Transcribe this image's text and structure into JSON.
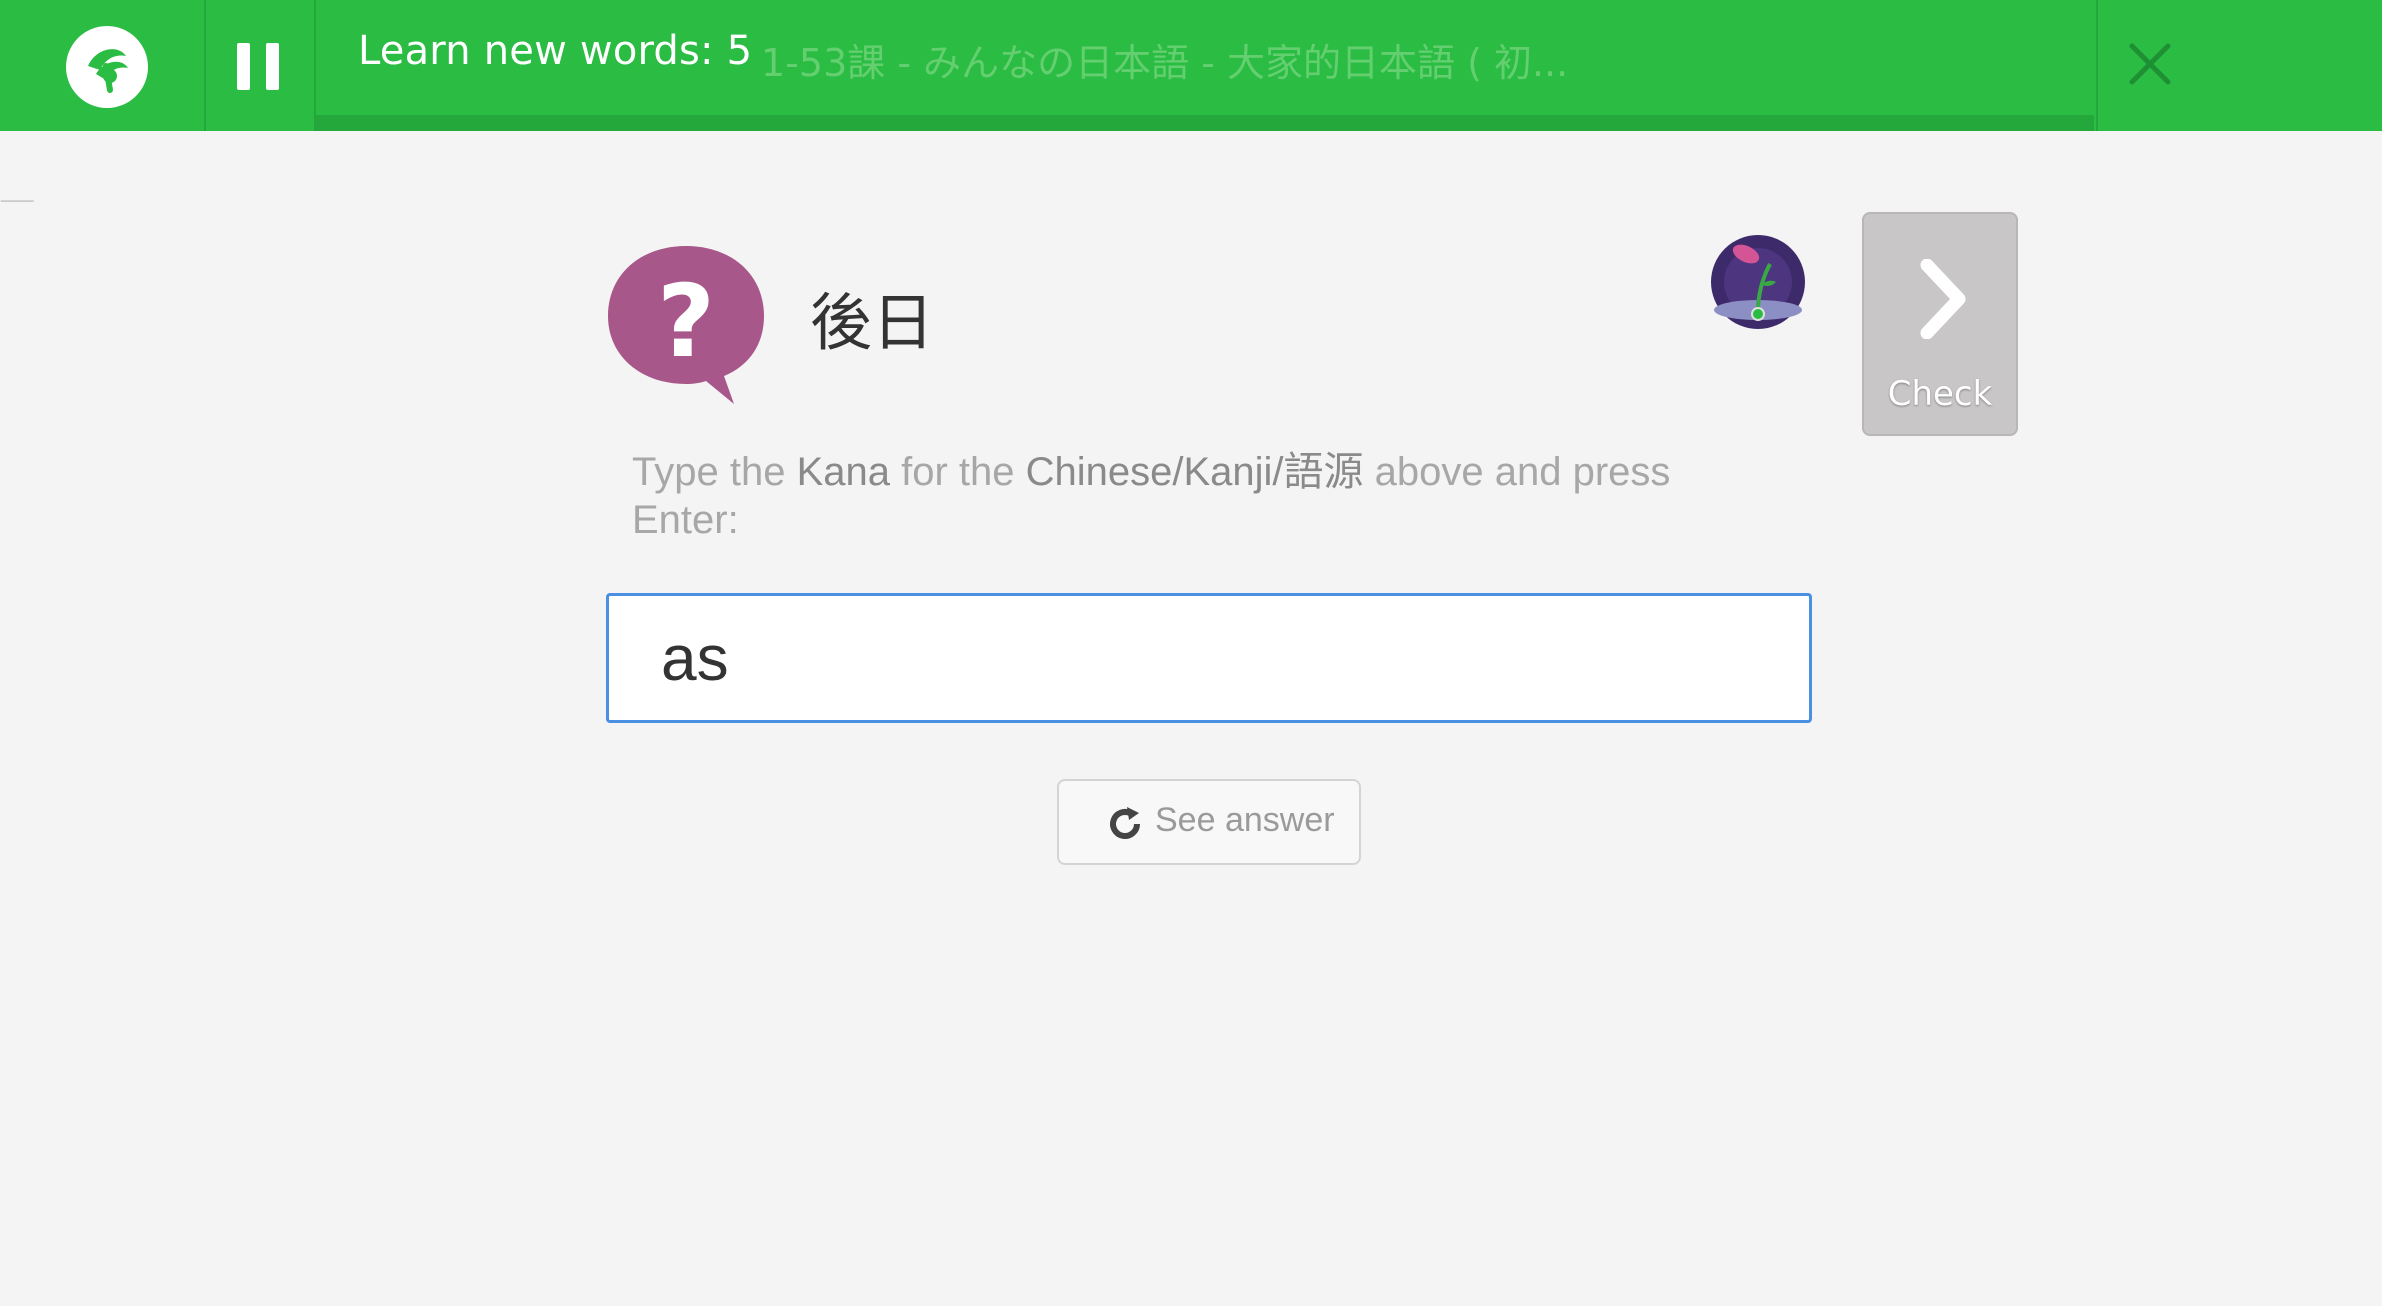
{
  "header": {
    "title": "Learn new words: 5",
    "course": "1-53課 - みんなの日本語 - 大家的日本語 ( 初...",
    "logo_icon": "memrise-sprout-icon",
    "pause_icon": "pause-icon",
    "close_icon": "close-icon"
  },
  "question": {
    "icon": "question-bubble-icon",
    "prompt": "後日",
    "mem_icon": "flower-mem-icon",
    "instruction_parts": {
      "p1": "Type the ",
      "b1": "Kana",
      "p2": " for the ",
      "b2": "Chinese/Kanji/語源",
      "p3": " above and press Enter:"
    }
  },
  "answer": {
    "value": "as"
  },
  "actions": {
    "check_label": "Check",
    "check_icon": "chevron-right-icon",
    "see_answer_label": "See answer",
    "see_answer_icon": "refresh-icon"
  },
  "colors": {
    "header_green": "#2bbc44",
    "question_purple": "#a8578a",
    "input_border": "#4a90e2"
  }
}
